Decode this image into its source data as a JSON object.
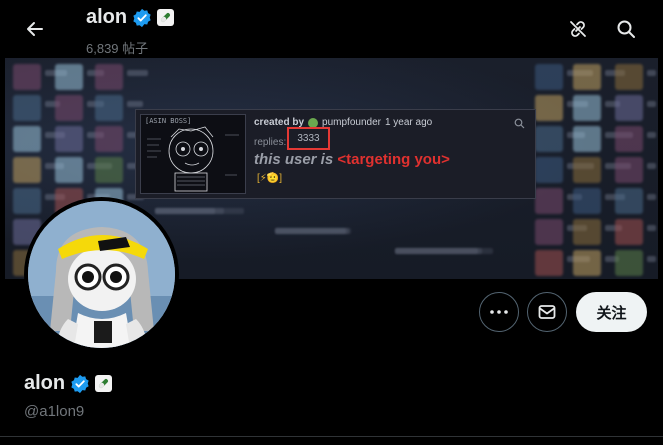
{
  "header": {
    "name": "alon",
    "post_count": "6,839 帖子",
    "icons": [
      "back-arrow-icon",
      "verified-badge-icon",
      "pill-badge-icon",
      "unlink-icon",
      "search-icon"
    ]
  },
  "banner": {
    "card": {
      "image_label": "[ASIN BOSS]",
      "created_prefix": "created by",
      "creator": "pumpfounder",
      "created_when": "1 year ago",
      "replies_label": "replies:",
      "replies_count": "3333",
      "headline_part1": "this user is",
      "headline_part2": "<targeting you>",
      "emojis": "[⚡🫡]"
    }
  },
  "actions": {
    "more_label": "…",
    "follow_label": "关注"
  },
  "profile": {
    "name": "alon",
    "handle": "@a1lon9"
  },
  "colors": {
    "background": "#000000",
    "verified_blue": "#1d9bf0",
    "highlight_red": "#e53935",
    "headline_red": "#e0312f",
    "follow_button": "#eff3f4"
  }
}
